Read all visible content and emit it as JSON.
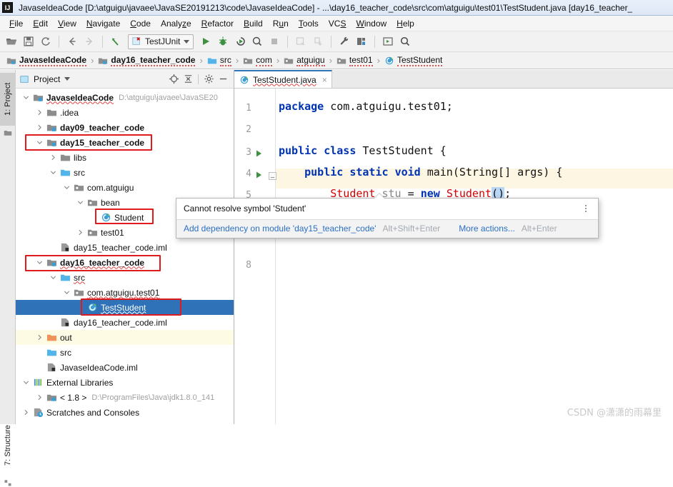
{
  "window": {
    "title": "JavaseIdeaCode [D:\\atguigu\\javaee\\JavaSE20191213\\code\\JavaseIdeaCode] - ...\\day16_teacher_code\\src\\com\\atguigu\\test01\\TestStudent.java [day16_teacher_",
    "logo": "IJ"
  },
  "menubar": {
    "items": [
      {
        "label": "File"
      },
      {
        "label": "Edit"
      },
      {
        "label": "View"
      },
      {
        "label": "Navigate"
      },
      {
        "label": "Code"
      },
      {
        "label": "Analyze"
      },
      {
        "label": "Refactor"
      },
      {
        "label": "Build"
      },
      {
        "label": "Run"
      },
      {
        "label": "Tools"
      },
      {
        "label": "VCS"
      },
      {
        "label": "Window"
      },
      {
        "label": "Help"
      }
    ]
  },
  "toolbar": {
    "run_config_label": "TestJUnit",
    "icons": [
      "open-folder-icon",
      "save-all-icon",
      "sync-refresh-icon",
      "back-arrow-icon",
      "forward-arrow-icon",
      "revert-icon",
      "run-icon",
      "debug-icon",
      "run-with-coverage-icon",
      "profile-icon",
      "stop-icon",
      "update-project-icon",
      "commit-icon",
      "settings-wrench-icon",
      "project-structure-icon",
      "select-in-icon",
      "search-everywhere-icon"
    ]
  },
  "breadcrumb": {
    "items": [
      {
        "label": "JavaseIdeaCode",
        "icon": "module-icon",
        "bold": true
      },
      {
        "label": "day16_teacher_code",
        "icon": "module-icon",
        "bold": true
      },
      {
        "label": "src",
        "icon": "source-folder-icon",
        "bold": false
      },
      {
        "label": "com",
        "icon": "package-icon",
        "bold": false
      },
      {
        "label": "atguigu",
        "icon": "package-icon",
        "bold": false
      },
      {
        "label": "test01",
        "icon": "package-icon",
        "bold": false
      },
      {
        "label": "TestStudent",
        "icon": "java-class-icon",
        "bold": false
      }
    ],
    "separator": "›"
  },
  "left_strip": {
    "project_tab": "1: Project",
    "structure_tab": "7: Structure"
  },
  "project_panel": {
    "title": "Project",
    "header_icons": [
      "locate-target-icon",
      "collapse-all-icon",
      "gear-icon",
      "hide-icon"
    ],
    "tree": [
      {
        "indent": 0,
        "arrow": "down",
        "icon": "module-icon",
        "label": "JavaseIdeaCode",
        "bold": true,
        "path": "D:\\atguigu\\javaee\\JavaSE20",
        "squiggle": true
      },
      {
        "indent": 1,
        "arrow": "right",
        "icon": "folder-icon",
        "label": ".idea",
        "bold": false
      },
      {
        "indent": 1,
        "arrow": "right",
        "icon": "module-icon",
        "label": "day09_teacher_code",
        "bold": true
      },
      {
        "indent": 1,
        "arrow": "down",
        "icon": "module-icon",
        "label": "day15_teacher_code",
        "bold": true
      },
      {
        "indent": 2,
        "arrow": "right",
        "icon": "folder-icon",
        "label": "libs",
        "bold": false
      },
      {
        "indent": 2,
        "arrow": "down",
        "icon": "source-folder-icon",
        "label": "src",
        "bold": false
      },
      {
        "indent": 3,
        "arrow": "down",
        "icon": "package-icon",
        "label": "com.atguigu",
        "bold": false
      },
      {
        "indent": 4,
        "arrow": "down",
        "icon": "package-icon",
        "label": "bean",
        "bold": false
      },
      {
        "indent": 5,
        "arrow": "none",
        "icon": "java-class-icon",
        "label": "Student",
        "bold": false
      },
      {
        "indent": 4,
        "arrow": "right",
        "icon": "package-icon",
        "label": "test01",
        "bold": false
      },
      {
        "indent": 2,
        "arrow": "none",
        "icon": "iml-file-icon",
        "label": "day15_teacher_code.iml",
        "bold": false
      },
      {
        "indent": 1,
        "arrow": "down",
        "icon": "module-icon",
        "label": "day16_teacher_code",
        "bold": true,
        "squiggle": true
      },
      {
        "indent": 2,
        "arrow": "down",
        "icon": "source-folder-icon",
        "label": "src",
        "bold": false,
        "squiggle": true
      },
      {
        "indent": 3,
        "arrow": "down",
        "icon": "package-icon",
        "label": "com.atguigu.test01",
        "bold": false,
        "squiggle": true
      },
      {
        "indent": 4,
        "arrow": "none",
        "icon": "java-class-icon",
        "label": "TestStudent",
        "bold": false,
        "selected": true,
        "squiggle": true
      },
      {
        "indent": 2,
        "arrow": "none",
        "icon": "iml-file-icon",
        "label": "day16_teacher_code.iml",
        "bold": false
      },
      {
        "indent": 1,
        "arrow": "right",
        "icon": "out-folder-icon",
        "label": "out",
        "bold": false,
        "highlight": true
      },
      {
        "indent": 1,
        "arrow": "none",
        "icon": "source-folder-icon",
        "label": "src",
        "bold": false
      },
      {
        "indent": 1,
        "arrow": "none",
        "icon": "iml-file-icon",
        "label": "JavaseIdeaCode.iml",
        "bold": false
      },
      {
        "indent": 0,
        "arrow": "down",
        "icon": "libraries-icon",
        "label": "External Libraries",
        "bold": false
      },
      {
        "indent": 1,
        "arrow": "right",
        "icon": "jdk-icon",
        "label": "< 1.8 >",
        "bold": false,
        "path": "D:\\ProgramFiles\\Java\\jdk1.8.0_141"
      },
      {
        "indent": 0,
        "arrow": "right",
        "icon": "scratches-icon",
        "label": "Scratches and Consoles",
        "bold": false
      }
    ]
  },
  "editor": {
    "tab": {
      "label": "TestStudent.java",
      "icon": "java-class-icon",
      "close": "×"
    },
    "lines": [
      {
        "num": "1",
        "run_marker": false
      },
      {
        "num": "2",
        "run_marker": false
      },
      {
        "num": "3",
        "run_marker": true
      },
      {
        "num": "4",
        "run_marker": true,
        "fold": true
      },
      {
        "num": "5",
        "run_marker": false,
        "highlight": true
      },
      {
        "num": "8",
        "run_marker": false
      }
    ],
    "code": {
      "line1_kw": "package",
      "line1_rest": " com.atguigu.test01;",
      "line3_kw1": "public",
      "line3_kw2": "class",
      "line3_name": "TestStudent",
      "line3_brace": "{",
      "line4_kw1": "public",
      "line4_kw2": "static",
      "line4_kw3": "void",
      "line4_name": "main",
      "line4_params": "(String[] args) {",
      "line5_type": "Student",
      "line5_var": "stu",
      "line5_eq": "=",
      "line5_kw": "new",
      "line5_ctor": "Student",
      "line5_parens": "()",
      "line5_semi": ";"
    }
  },
  "popup": {
    "message": "Cannot resolve symbol 'Student'",
    "action_link": "Add dependency on module 'day15_teacher_code'",
    "action_shortcut": "Alt+Shift+Enter",
    "more_actions": "More actions...",
    "more_shortcut": "Alt+Enter",
    "kebab": "more-options-icon"
  },
  "watermark": "CSDN @潇潇的雨幕里",
  "colors": {
    "selection_blue": "#2f72b8",
    "annotation_red": "#e01b1b",
    "keyword_blue": "#0033b3",
    "error_red": "#d40000",
    "link_blue": "#2b6fc4",
    "highlight_yellow": "#fdf6e3"
  }
}
